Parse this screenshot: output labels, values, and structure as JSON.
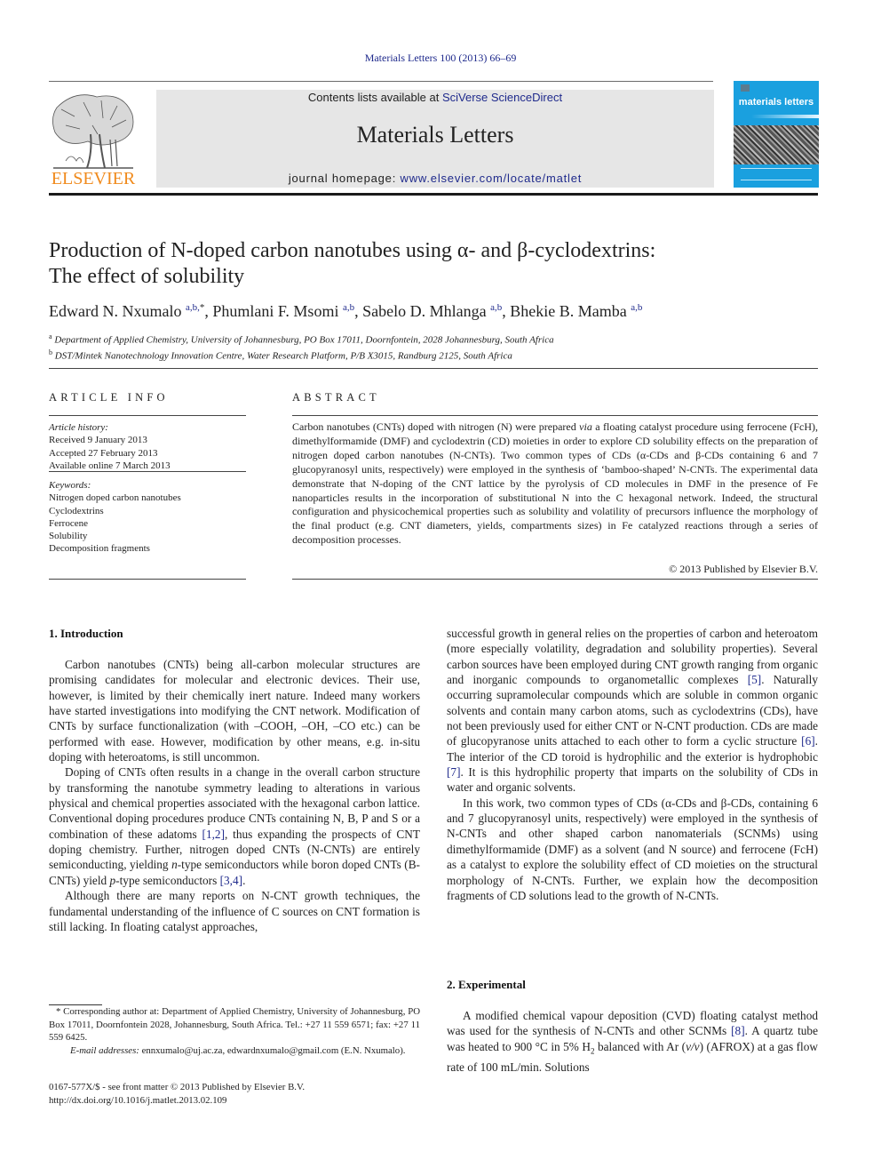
{
  "running_head": "Materials Letters 100 (2013) 66–69",
  "masthead": {
    "contents_prefix": "Contents lists available at ",
    "contents_link": "SciVerse ScienceDirect",
    "journal_name": "Materials Letters",
    "homepage_prefix": "journal homepage: ",
    "homepage_link": "www.elsevier.com/locate/matlet",
    "publisher_logo_text": "ELSEVIER",
    "cover_title": "materials letters",
    "brand_orange": "#f08a1c",
    "cover_blue": "#1aa0df",
    "link_blue": "#1f2a8c"
  },
  "article": {
    "title_line1": "Production of N-doped carbon nanotubes using α- and β-cyclodextrins:",
    "title_line2": "The effect of solubility",
    "authors": [
      {
        "name": "Edward N. Nxumalo",
        "sup": "a,b,",
        "corresponding": "*"
      },
      {
        "name": "Phumlani F. Msomi",
        "sup": "a,b"
      },
      {
        "name": "Sabelo D. Mhlanga",
        "sup": "a,b"
      },
      {
        "name": "Bhekie B. Mamba",
        "sup": "a,b"
      }
    ],
    "affiliations": [
      {
        "mark": "a",
        "text": "Department of Applied Chemistry, University of Johannesburg, PO Box 17011, Doornfontein, 2028 Johannesburg, South Africa"
      },
      {
        "mark": "b",
        "text": "DST/Mintek Nanotechnology Innovation Centre, Water Research Platform, P/B X3015, Randburg 2125, South Africa"
      }
    ]
  },
  "article_info": {
    "heading": "ARTICLE INFO",
    "history_label": "Article history:",
    "history": [
      "Received 9 January 2013",
      "Accepted 27 February 2013",
      "Available online 7 March 2013"
    ],
    "keywords_label": "Keywords:",
    "keywords": [
      "Nitrogen doped carbon nanotubes",
      "Cyclodextrins",
      "Ferrocene",
      "Solubility",
      "Decomposition fragments"
    ]
  },
  "abstract": {
    "heading": "ABSTRACT",
    "text_part1": "Carbon nanotubes (CNTs) doped with nitrogen (N) were prepared ",
    "text_via": "via",
    "text_part2": " a floating catalyst procedure using ferrocene (FcH), dimethylformamide (DMF) and cyclodextrin (CD) moieties in order to explore CD solubility effects on the preparation of nitrogen doped carbon nanotubes (N-CNTs). Two common types of CDs (α-CDs and β-CDs containing 6 and 7 glucopyranosyl units, respectively) were employed in the synthesis of ‘bamboo-shaped’ N-CNTs. The experimental data demonstrate that N-doping of the CNT lattice by the pyrolysis of CD molecules in DMF in the presence of Fe nanoparticles results in the incorporation of substitutional N into the C hexagonal network. Indeed, the structural configuration and physicochemical properties such as solubility and volatility of precursors influence the morphology of the final product (e.g. CNT diameters, yields, compartments sizes) in Fe catalyzed reactions through a series of decomposition processes.",
    "copyright": "© 2013 Published by Elsevier B.V."
  },
  "sections": {
    "intro_heading": "1.  Introduction",
    "intro_p1": "Carbon nanotubes (CNTs) being all-carbon molecular structures are promising candidates for molecular and electronic devices. Their use, however, is limited by their chemically inert nature. Indeed many workers have started investigations into modifying the CNT network. Modification of CNTs by surface functionalization (with –COOH, –OH, –CO etc.) can be performed with ease. However, modification by other means, e.g. in-situ doping with heteroatoms, is still uncommon.",
    "intro_p2_a": "Doping of CNTs often results in a change in the overall carbon structure by transforming the nanotube symmetry leading to alterations in various physical and chemical properties associated with the hexagonal carbon lattice. Conventional doping procedures produce CNTs containing N, B, P and S or a combination of these adatoms ",
    "intro_p2_cite1": "[1,2]",
    "intro_p2_b": ", thus expanding the prospects of CNT doping chemistry. Further, nitrogen doped CNTs (N-CNTs) are entirely semiconducting, yielding ",
    "intro_p2_n": "n",
    "intro_p2_c": "-type semiconductors while boron doped CNTs (B-CNTs) yield ",
    "intro_p2_p": "p",
    "intro_p2_d": "-type semiconductors ",
    "intro_p2_cite2": "[3,4]",
    "intro_p2_e": ".",
    "intro_p3": "Although there are many reports on N-CNT growth techniques, the fundamental understanding of the influence of C sources on CNT formation is still lacking. In floating catalyst approaches,",
    "right_p1_a": "successful growth in general relies on the properties of carbon and heteroatom (more especially volatility, degradation and solubility properties). Several carbon sources have been employed during CNT growth ranging from organic and inorganic compounds to organometallic complexes ",
    "right_p1_cite5": "[5]",
    "right_p1_b": ". Naturally occurring supramolecular compounds which are soluble in common organic solvents and contain many carbon atoms, such as cyclodextrins (CDs), have not been previously used for either CNT or N-CNT production. CDs are made of glucopyranose units attached to each other to form a cyclic structure ",
    "right_p1_cite6": "[6]",
    "right_p1_c": ". The interior of the CD toroid is hydrophilic and the exterior is hydrophobic ",
    "right_p1_cite7": "[7]",
    "right_p1_d": ". It is this hydrophilic property that imparts on the solubility of CDs in water and organic solvents.",
    "right_p2": "In this work, two common types of CDs (α-CDs and β-CDs, containing 6 and 7 glucopyranosyl units, respectively) were employed in the synthesis of N-CNTs and other shaped carbon nanomaterials (SCNMs) using dimethylformamide (DMF) as a solvent (and N source) and ferrocene (FcH) as a catalyst to explore the solubility effect of CD moieties on the structural morphology of N-CNTs. Further, we explain how the decomposition fragments of CD solutions lead to the growth of N-CNTs.",
    "exp_heading": "2.  Experimental",
    "exp_p1_a": "A modified chemical vapour deposition (CVD) floating catalyst method was used for the synthesis of N-CNTs and other SCNMs ",
    "exp_p1_cite8": "[8]",
    "exp_p1_b": ". A quartz tube was heated to 900 °C in 5% H",
    "exp_p1_sub": "2",
    "exp_p1_c": " balanced with Ar (",
    "exp_p1_vv": "v/v",
    "exp_p1_d": ") (AFROX) at a gas flow rate of 100 mL/min. Solutions"
  },
  "footnote": {
    "corresponding": "* Corresponding author at: Department of Applied Chemistry, University of Johannesburg, PO Box 17011, Doornfontein 2028, Johannesburg, South Africa. Tel.: +27 11 559 6571; fax: +27 11 559 6425.",
    "email_label": "E-mail addresses:",
    "emails": " ennxumalo@uj.ac.za, edwardnxumalo@gmail.com (E.N. Nxumalo)."
  },
  "front_matter": {
    "issn_line": "0167-577X/$ - see front matter © 2013 Published by Elsevier B.V.",
    "doi": "http://dx.doi.org/10.1016/j.matlet.2013.02.109"
  }
}
